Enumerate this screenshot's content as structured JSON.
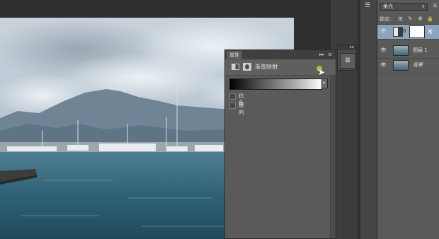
{
  "app": "Photoshop",
  "colors": {
    "panel_bg": "#5a5a58",
    "selection": "#8aa3be",
    "pointer_dot": "#9bc53d"
  },
  "properties_panel": {
    "tab_label": "属性",
    "collapse_glyph": "▸▸",
    "menu_glyph": "≡",
    "adjustment_title": "渐变映射",
    "gradient_dropdown_glyph": "▾",
    "options": [
      {
        "label": "仿色",
        "checked": false
      },
      {
        "label": "反向",
        "checked": false
      }
    ]
  },
  "dock": {
    "collapse_glyph": "▸▸",
    "properties_button_icon": "adjustments-icon",
    "properties_button_glyph": "≣"
  },
  "layers_panel": {
    "blend_mode": "柔光",
    "blend_arrow": "⇕",
    "opacity_label": "不",
    "lock_label": "锁定:",
    "lock_icons": [
      "⊞",
      "✎",
      "✥",
      "🔒"
    ],
    "layers": [
      {
        "name": "渐",
        "type": "adjustment",
        "selected": true,
        "visible": true
      },
      {
        "name": "图层 1",
        "type": "pixel",
        "selected": false,
        "visible": true
      },
      {
        "name": "背景",
        "type": "background",
        "selected": false,
        "visible": true
      }
    ],
    "eye_glyph": "👁",
    "link_glyph": "8",
    "strip_icon": "☰"
  }
}
